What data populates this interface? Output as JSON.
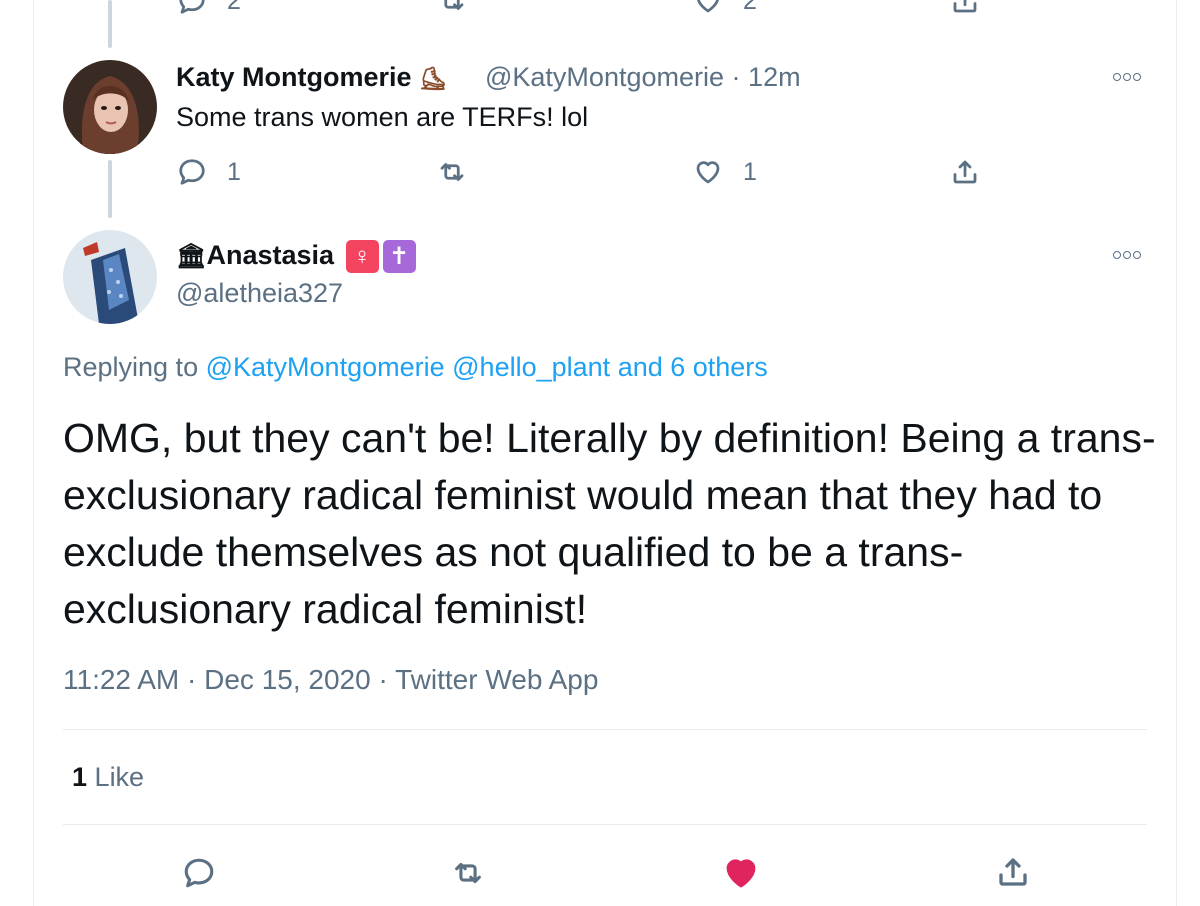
{
  "top_tweet_actions": {
    "reply_count": "2",
    "like_count": "2"
  },
  "tweet_katy": {
    "display_name": "Katy Montgomerie",
    "name_emoji": "🛼",
    "handle": "@KatyMontgomerie",
    "separator": "·",
    "time_ago": "12m",
    "text": "Some trans women are TERFs! lol",
    "reply_count": "1",
    "like_count": "1"
  },
  "tweet_main": {
    "name_prefix_icon": "🏛",
    "display_name": "Anastasia",
    "badge_female": "♀",
    "badge_cross": "✝",
    "handle": "@aletheia327",
    "replying_label": "Replying to",
    "replying_to": [
      "@KatyMontgomerie",
      "@hello_plant",
      "and 6 others"
    ],
    "text": "OMG, but they can't be! Literally by definition! Being a trans-exclusionary radical feminist would mean that they had to exclude themselves as not qualified to be a trans-exclusionary radical feminist!",
    "time": "11:22 AM",
    "sep1": "·",
    "date": "Dec 15, 2020",
    "sep2": "·",
    "source": "Twitter Web App",
    "likes_count": "1",
    "likes_label": "Like"
  },
  "colors": {
    "link": "#1da1f2",
    "muted": "#5b7083",
    "liked": "#e0245e",
    "badge_pink": "#f4445f",
    "badge_purple": "#a769d9"
  }
}
